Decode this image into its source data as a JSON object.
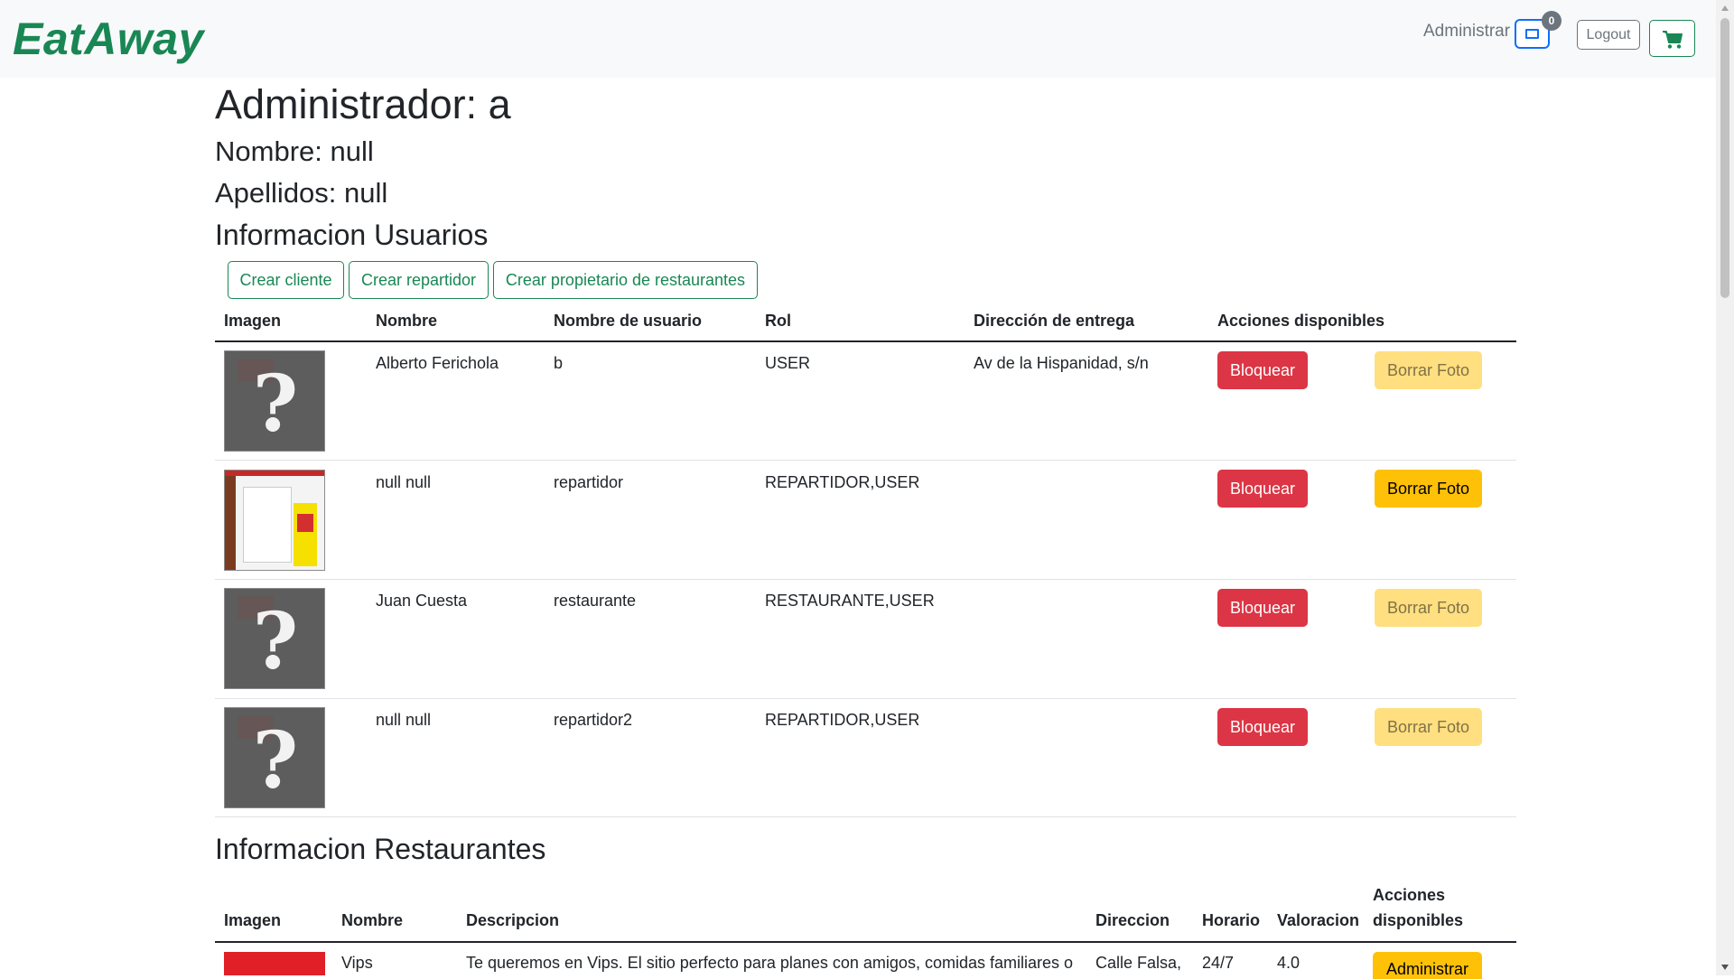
{
  "navbar": {
    "brand": "EatAway",
    "admin_link": "Administrar",
    "messages_badge": "0",
    "logout_label": "Logout"
  },
  "profile": {
    "admin_title": "Administrador: a",
    "nombre": "Nombre: null",
    "apellidos": "Apellidos: null"
  },
  "users_section": {
    "title": "Informacion Usuarios",
    "buttons": [
      "Crear cliente",
      "Crear repartidor",
      "Crear propietario de restaurantes"
    ],
    "headers": [
      "Imagen",
      "Nombre",
      "Nombre de usuario",
      "Rol",
      "Dirección de entrega",
      "Acciones disponibles"
    ],
    "rows": [
      {
        "image": "placeholder",
        "name": "Alberto Ferichola",
        "username": "b",
        "role": "USER",
        "address": "Av de la Hispanidad, s/n",
        "block": "Bloquear",
        "delete_photo": "Borrar Foto",
        "delete_enabled": false
      },
      {
        "image": "screenshot",
        "name": "null null",
        "username": "repartidor",
        "role": "REPARTIDOR,USER",
        "address": "",
        "block": "Bloquear",
        "delete_photo": "Borrar Foto",
        "delete_enabled": true
      },
      {
        "image": "placeholder",
        "name": "Juan Cuesta",
        "username": "restaurante",
        "role": "RESTAURANTE,USER",
        "address": "",
        "block": "Bloquear",
        "delete_photo": "Borrar Foto",
        "delete_enabled": false
      },
      {
        "image": "placeholder",
        "name": "null null",
        "username": "repartidor2",
        "role": "REPARTIDOR,USER",
        "address": "",
        "block": "Bloquear",
        "delete_photo": "Borrar Foto",
        "delete_enabled": false
      }
    ]
  },
  "restaurants_section": {
    "title": "Informacion Restaurantes",
    "headers": {
      "imagen": "Imagen",
      "nombre": "Nombre",
      "descripcion": "Descripcion",
      "direccion": "Direccion",
      "horario": "Horario",
      "valoracion": "Valoracion",
      "acciones_1": "Acciones",
      "acciones_2": "disponibles"
    },
    "rows": [
      {
        "name": "Vips",
        "description": "Te queremos en Vips. El sitio perfecto para planes con amigos, comidas familiares o",
        "address": "Calle Falsa,",
        "schedule": "24/7",
        "rating": "4.0",
        "action": "Administrar"
      }
    ]
  },
  "colors": {
    "brand": "#198754",
    "danger": "#dc3545",
    "warning": "#ffc107",
    "primary": "#0d6efd"
  }
}
